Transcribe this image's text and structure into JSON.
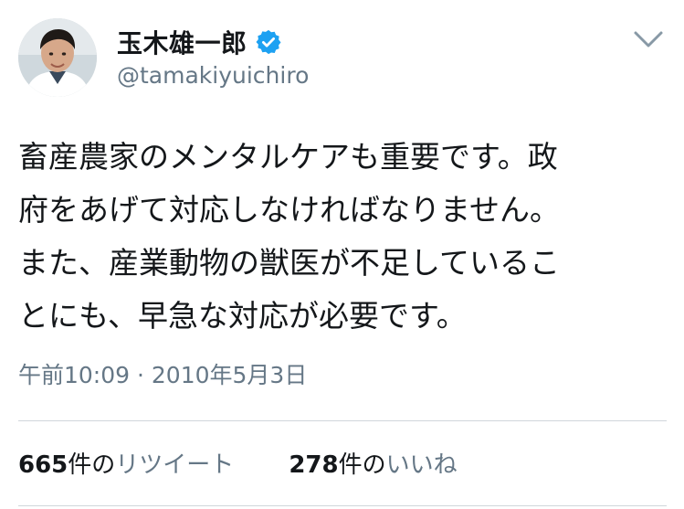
{
  "author": {
    "display_name": "玉木雄一郎",
    "handle": "@tamakiyuichiro",
    "verified_icon": "verified-badge-icon",
    "accent_color": "#1da1f2"
  },
  "tweet": {
    "lines": [
      "畜産農家のメンタルケアも重要です。政",
      "府をあげて対応しなければなりません。",
      "また、産業動物の獣医が不足しているこ",
      "とにも、早急な対応が必要です。"
    ],
    "timestamp": "午前10:09 · 2010年5月3日"
  },
  "stats": {
    "retweets": {
      "count": "665",
      "unit": "件の",
      "label": "リツイート"
    },
    "likes": {
      "count": "278",
      "unit": "件の",
      "label": "いいね"
    }
  },
  "menu": {
    "icon": "chevron-down-icon"
  },
  "colors": {
    "text": "#14171a",
    "secondary": "#657786",
    "divider": "#d0d6db"
  }
}
